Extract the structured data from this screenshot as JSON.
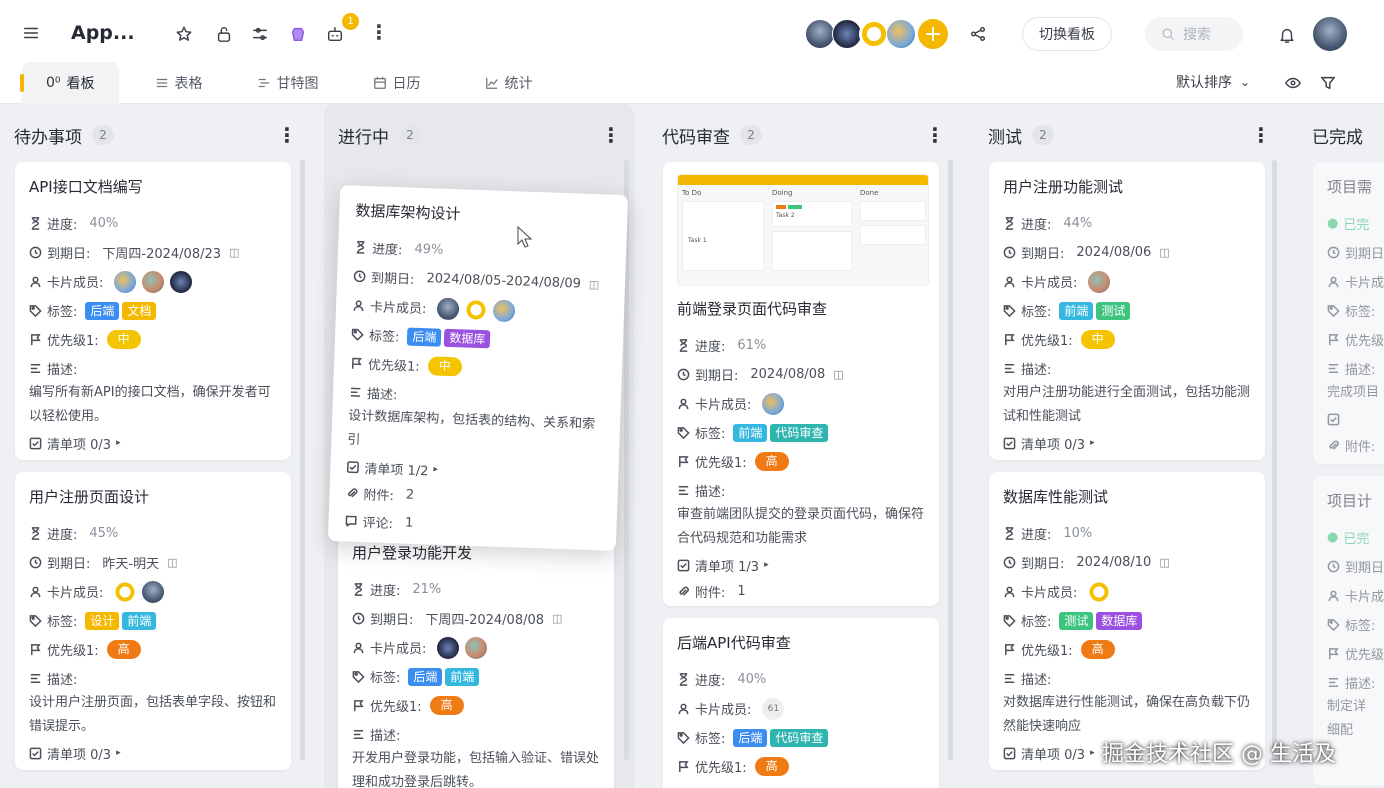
{
  "app": {
    "title": "App...",
    "badge_count": "1"
  },
  "topbar": {
    "switch_board": "切换看板",
    "search_placeholder": "搜索"
  },
  "tabs": [
    {
      "label": "看板",
      "icon": "board-icon",
      "active": true
    },
    {
      "label": "表格",
      "icon": "list-icon"
    },
    {
      "label": "甘特图",
      "icon": "gantt-icon"
    },
    {
      "label": "日历",
      "icon": "calendar-icon"
    },
    {
      "label": "统计",
      "icon": "chart-icon"
    }
  ],
  "sort": {
    "label": "默认排序"
  },
  "labels": {
    "progress": "进度:",
    "due": "到期日:",
    "members": "卡片成员:",
    "tags": "标签:",
    "priority": "优先级1:",
    "desc": "描述:",
    "attachments": "附件:",
    "comments": "评论:"
  },
  "columns": [
    {
      "title": "待办事项",
      "count": "2"
    },
    {
      "title": "进行中",
      "count": "2"
    },
    {
      "title": "代码审查",
      "count": "2"
    },
    {
      "title": "测试",
      "count": "2"
    },
    {
      "title": "已完成"
    }
  ],
  "cards": {
    "c1": {
      "title": "API接口文档编写",
      "progress": "40%",
      "due": "下周四-2024/08/23",
      "tags": [
        "后端",
        "文档"
      ],
      "priority": "中",
      "desc": "编写所有新API的接口文档，确保开发者可以轻松使用。",
      "checklist": "清单项 0/3"
    },
    "c2": {
      "title": "用户注册页面设计",
      "progress": "45%",
      "due": "昨天-明天",
      "tags": [
        "设计",
        "前端"
      ],
      "priority": "高",
      "desc": "设计用户注册页面，包括表单字段、按钮和错误提示。",
      "checklist": "清单项 0/3"
    },
    "c3": {
      "title": "数据库架构设计",
      "progress": "49%",
      "due": "2024/08/05-2024/08/09",
      "tags": [
        "后端",
        "数据库"
      ],
      "priority": "中",
      "desc": "设计数据库架构，包括表的结构、关系和索引",
      "checklist": "清单项 1/2",
      "attachments": "2",
      "comments": "1"
    },
    "c4": {
      "title": "用户登录功能开发",
      "progress": "21%",
      "due": "下周四-2024/08/08",
      "tags": [
        "后端",
        "前端"
      ],
      "priority": "高",
      "desc": "开发用户登录功能，包括输入验证、错误处理和成功登录后跳转。"
    },
    "c5": {
      "title": "前端登录页面代码审查",
      "progress": "61%",
      "due": "2024/08/08",
      "tags": [
        "前端",
        "代码审查"
      ],
      "priority": "高",
      "desc": "审查前端团队提交的登录页面代码，确保符合代码规范和功能需求",
      "checklist": "清单项 1/3",
      "attachments": "1",
      "thumb": {
        "cols": [
          "To Do",
          "Doing",
          "Done"
        ],
        "task1": "Task 1",
        "task2": "Task 2"
      }
    },
    "c6": {
      "title": "后端API代码审查",
      "progress": "40%",
      "tags": [
        "后端",
        "代码审查"
      ],
      "priority": "高",
      "member_label": "61"
    },
    "c7": {
      "title": "用户注册功能测试",
      "progress": "44%",
      "due": "2024/08/06",
      "tags": [
        "前端",
        "测试"
      ],
      "priority": "中",
      "desc": "对用户注册功能进行全面测试，包括功能测试和性能测试",
      "checklist": "清单项 0/3"
    },
    "c8": {
      "title": "数据库性能测试",
      "progress": "10%",
      "due": "2024/08/10",
      "tags": [
        "测试",
        "数据库"
      ],
      "priority": "高",
      "desc": "对数据库进行性能测试，确保在高负载下仍然能快速响应",
      "checklist": "清单项 0/3"
    },
    "c9": {
      "title": "项目需",
      "status": "已完",
      "desc": "完成项目"
    },
    "c10": {
      "title": "项目计",
      "status": "已完",
      "desc": "制定详细配"
    }
  },
  "watermark": "掘金技术社区 @ 生活及",
  "colors": {
    "accent": "#f5b800",
    "high": "#f07b15",
    "backend": "#3b8ef0",
    "frontend": "#35b8e0",
    "database": "#9b51e0",
    "test": "#3dc47e",
    "code_review": "#2fb5b0"
  }
}
